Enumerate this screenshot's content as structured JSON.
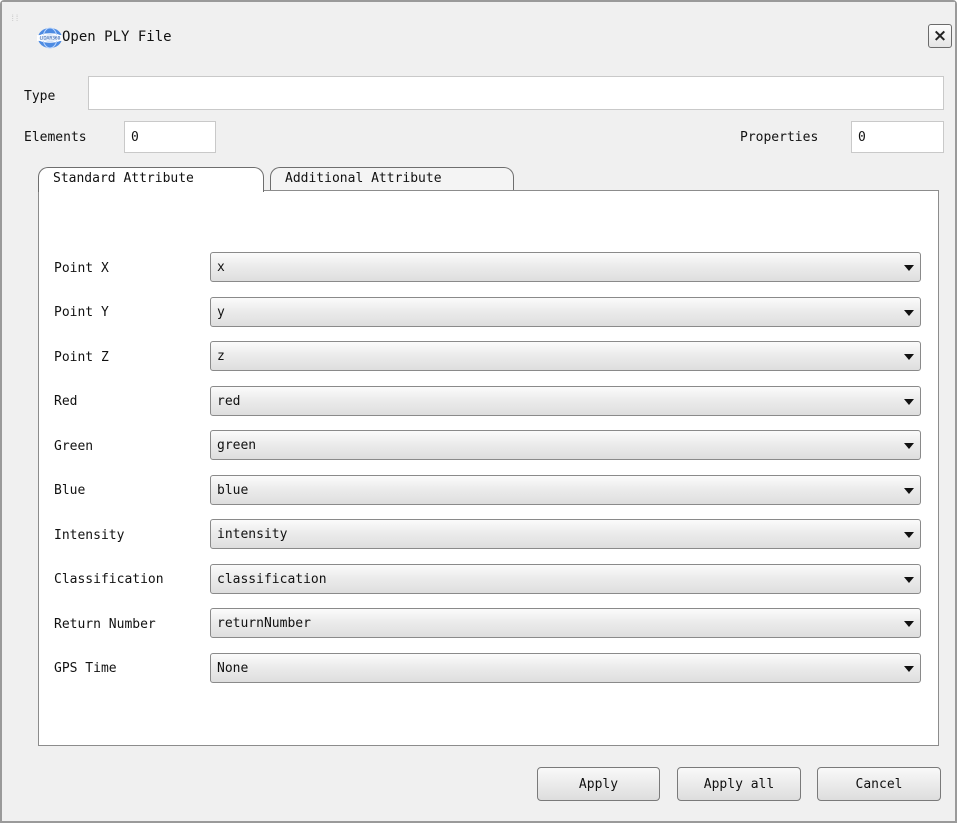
{
  "window": {
    "title": "Open PLY File",
    "logo_text": "LIDAR360",
    "close_glyph": "×"
  },
  "form": {
    "type_label": "Type",
    "type_value": "",
    "elements_label": "Elements",
    "elements_value": "0",
    "properties_label": "Properties",
    "properties_value": "0"
  },
  "tabs": [
    {
      "label": "Standard Attribute",
      "active": true
    },
    {
      "label": "Additional Attribute",
      "active": false
    }
  ],
  "attributes": [
    {
      "label": "Point X",
      "value": "x"
    },
    {
      "label": "Point Y",
      "value": "y"
    },
    {
      "label": "Point Z",
      "value": "z"
    },
    {
      "label": "Red",
      "value": "red"
    },
    {
      "label": "Green",
      "value": "green"
    },
    {
      "label": "Blue",
      "value": "blue"
    },
    {
      "label": "Intensity",
      "value": "intensity"
    },
    {
      "label": "Classification",
      "value": "classification"
    },
    {
      "label": "Return Number",
      "value": "returnNumber"
    },
    {
      "label": "GPS Time",
      "value": "None"
    }
  ],
  "buttons": {
    "apply": "Apply",
    "apply_all": "Apply all",
    "cancel": "Cancel"
  },
  "colors": {
    "dialog_bg": "#f0f0f0",
    "panel_bg": "#ffffff",
    "logo_blue": "#2a6fd6"
  },
  "icons": {
    "logo": "app-logo-icon",
    "close": "close-icon",
    "dropdown": "chevron-down-icon"
  }
}
